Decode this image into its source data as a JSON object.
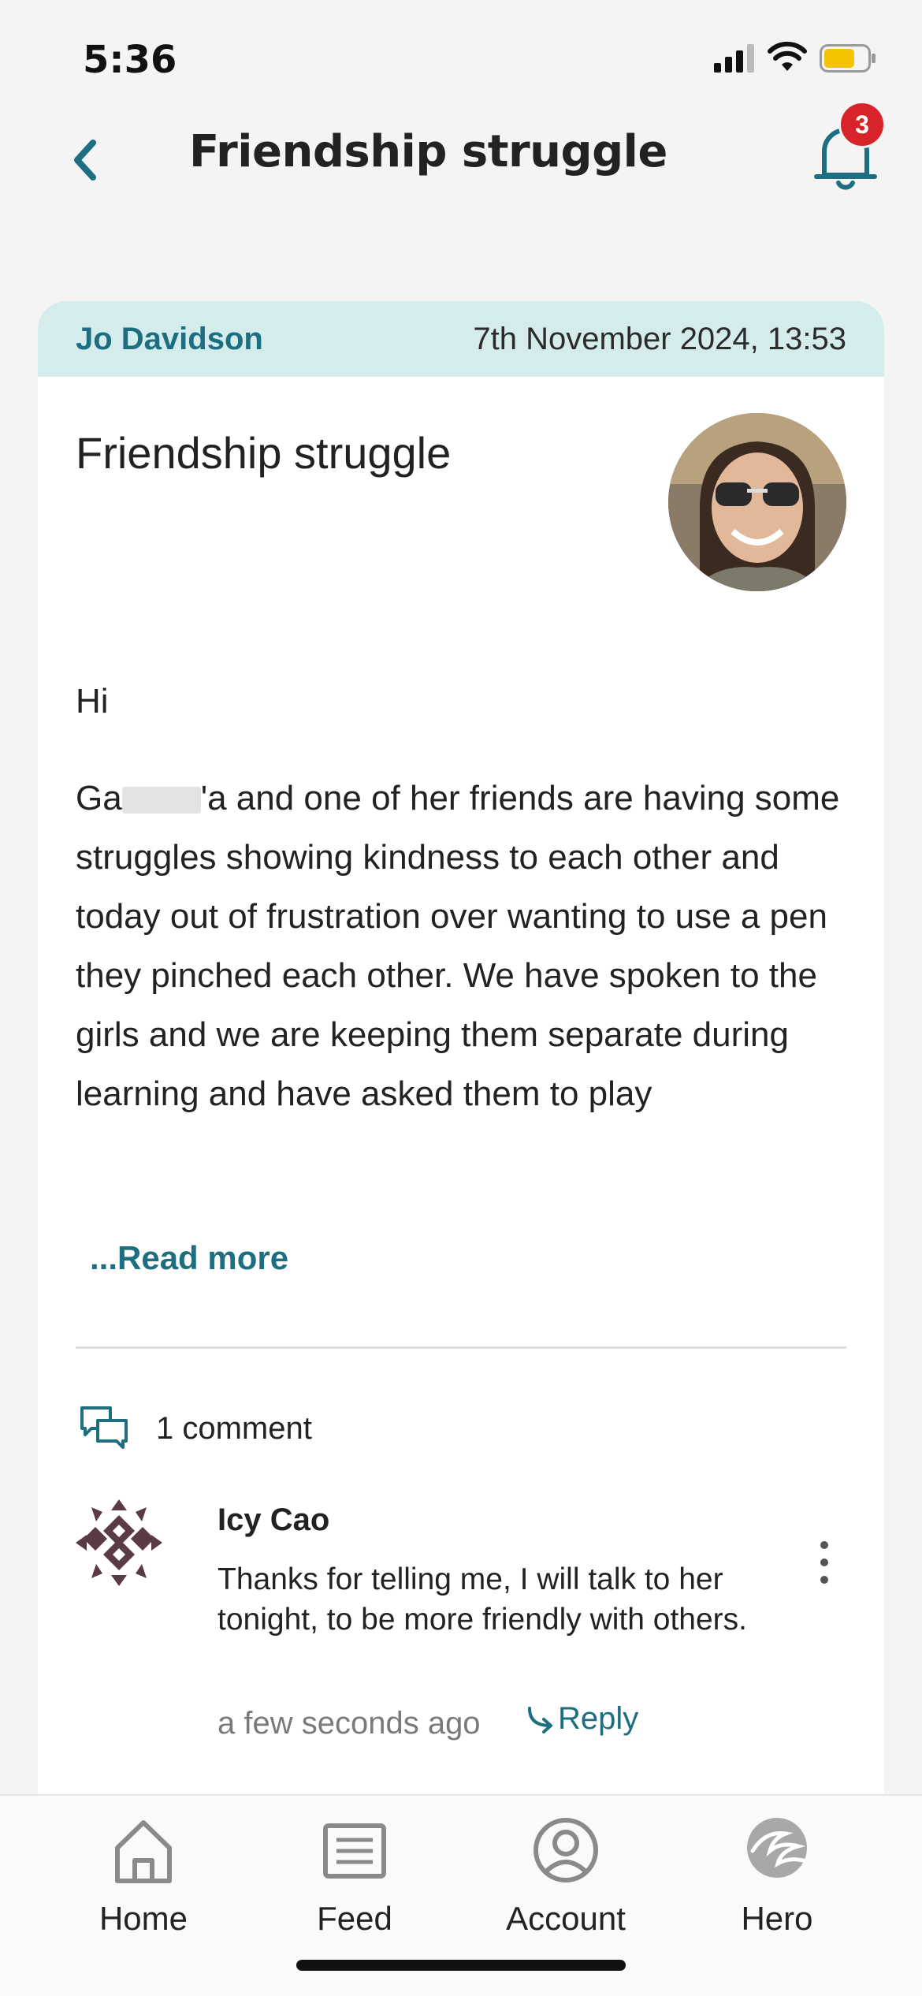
{
  "status_bar": {
    "time": "5:36"
  },
  "header": {
    "title": "Friendship struggle",
    "notification_count": "3"
  },
  "post": {
    "author": "Jo Davidson",
    "date": "7th November 2024, 13:53",
    "title": "Friendship struggle",
    "greeting": "Hi",
    "body_before": "Ga",
    "body_after": "'a and one of her friends are having some struggles showing kindness to each other and today out of frustration over wanting to use a pen they pinched each other.  We have spoken to the girls and we are keeping them separate during learning and have asked them to play",
    "read_more": "...Read more",
    "comment_count": "1 comment"
  },
  "comment": {
    "author": "Icy Cao",
    "text": "Thanks for telling me, I will talk to her tonight, to be more friendly with others.",
    "time": "a few seconds ago",
    "reply": "Reply"
  },
  "nav": {
    "items": [
      {
        "label": "Home"
      },
      {
        "label": "Feed"
      },
      {
        "label": "Account"
      },
      {
        "label": "Hero"
      }
    ]
  },
  "colors": {
    "accent": "#1c6e80",
    "card_header": "#d4ecec",
    "badge": "#d8232a",
    "battery": "#f5c400"
  }
}
